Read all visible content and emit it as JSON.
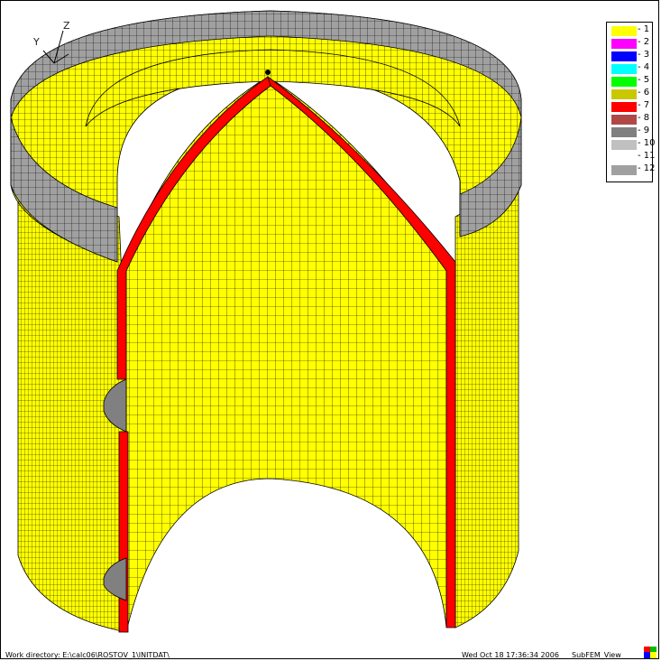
{
  "axes": {
    "y_label": "Y",
    "z_label": "Z"
  },
  "legend": {
    "items": [
      {
        "label": "- 1",
        "color": "#ffff00"
      },
      {
        "label": "- 2",
        "color": "#ff00ff"
      },
      {
        "label": "- 3",
        "color": "#0000ff"
      },
      {
        "label": "- 4",
        "color": "#00ffff"
      },
      {
        "label": "- 5",
        "color": "#00ff00"
      },
      {
        "label": "- 6",
        "color": "#c8c800"
      },
      {
        "label": "- 7",
        "color": "#ff0000"
      },
      {
        "label": "- 8",
        "color": "#b04848"
      },
      {
        "label": "- 9",
        "color": "#808080"
      },
      {
        "label": "- 10",
        "color": "#c0c0c0"
      },
      {
        "label": "- 11",
        "color": "#ffffff"
      },
      {
        "label": "- 12",
        "color": "#a0a0a0"
      }
    ]
  },
  "status": {
    "work_directory": "Work directory: E:\\calc06\\ROSTOV_1\\INITDAT\\",
    "datetime": "Wed Oct 18 17:36:34 2006",
    "app_name": "SubFEM_View"
  },
  "colors": {
    "mesh_yellow": "#ffff00",
    "mesh_line": "#000000",
    "cladding_red": "#ff0000",
    "flange_gray": "#a0a0a0"
  }
}
